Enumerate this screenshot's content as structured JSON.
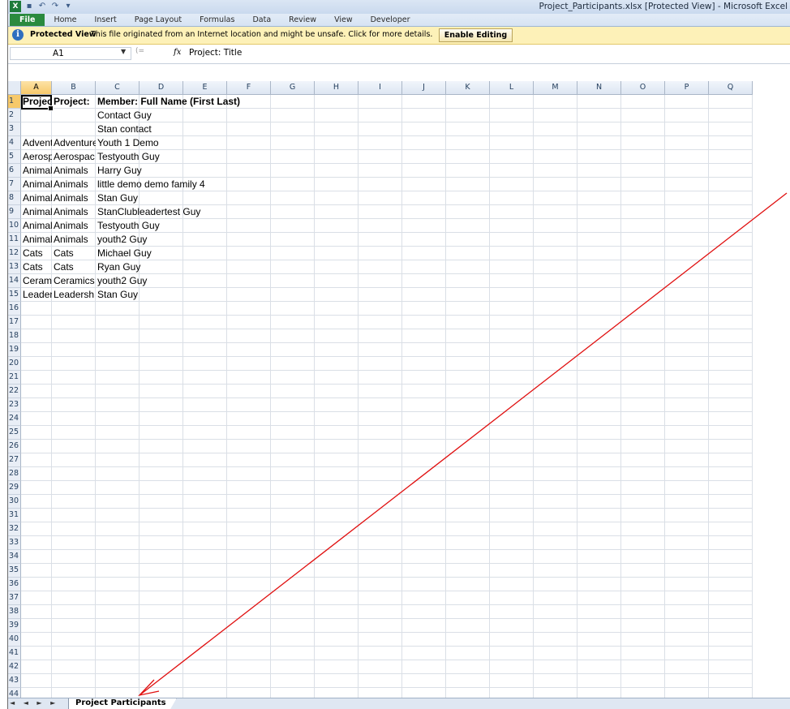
{
  "window": {
    "app_icon": "X",
    "title": "Project_Participants.xlsx  [Protected View]  -  Microsoft Excel"
  },
  "ribbon": {
    "tabs": [
      "File",
      "Home",
      "Insert",
      "Page Layout",
      "Formulas",
      "Data",
      "Review",
      "View",
      "Developer"
    ]
  },
  "protected_view": {
    "label": "Protected View",
    "message": "This file originated from an Internet location and might be unsafe. Click for more details.",
    "button": "Enable Editing"
  },
  "formula_bar": {
    "name_box": "A1",
    "fx": "fx",
    "value": "Project: Title"
  },
  "sheet": {
    "columns": [
      "A",
      "B",
      "C",
      "D",
      "E",
      "F",
      "G",
      "H",
      "I",
      "J",
      "K",
      "L",
      "M",
      "N",
      "O",
      "P",
      "Q"
    ],
    "selected_cell": "A1",
    "row_count": 44,
    "rows": [
      [
        "Project:",
        "Project: ",
        "Member: Full Name (First Last)"
      ],
      [
        "",
        "",
        "Contact Guy"
      ],
      [
        "",
        "",
        "Stan contact"
      ],
      [
        "Adventure",
        "Adventure",
        "Youth 1 Demo"
      ],
      [
        "Aerospac",
        "Aerospac",
        "Testyouth Guy"
      ],
      [
        "Animals",
        "Animals",
        "Harry Guy"
      ],
      [
        "Animals",
        "Animals",
        "little demo demo family 4"
      ],
      [
        "Animals",
        "Animals",
        "Stan Guy"
      ],
      [
        "Animals",
        "Animals",
        "StanClubleadertest Guy"
      ],
      [
        "Animals",
        "Animals",
        "Testyouth Guy"
      ],
      [
        "Animals",
        "Animals",
        "youth2 Guy"
      ],
      [
        "Cats",
        "Cats",
        "Michael Guy"
      ],
      [
        "Cats",
        "Cats",
        "Ryan Guy"
      ],
      [
        "Ceramics",
        "Ceramics",
        "youth2 Guy"
      ],
      [
        "Leadersh",
        "Leadersh",
        "Stan Guy"
      ]
    ]
  },
  "sheet_tabs": {
    "nav": "◄ ◄ ► ►",
    "active": "Project Participants"
  },
  "annotation": {
    "color": "#e01010"
  }
}
